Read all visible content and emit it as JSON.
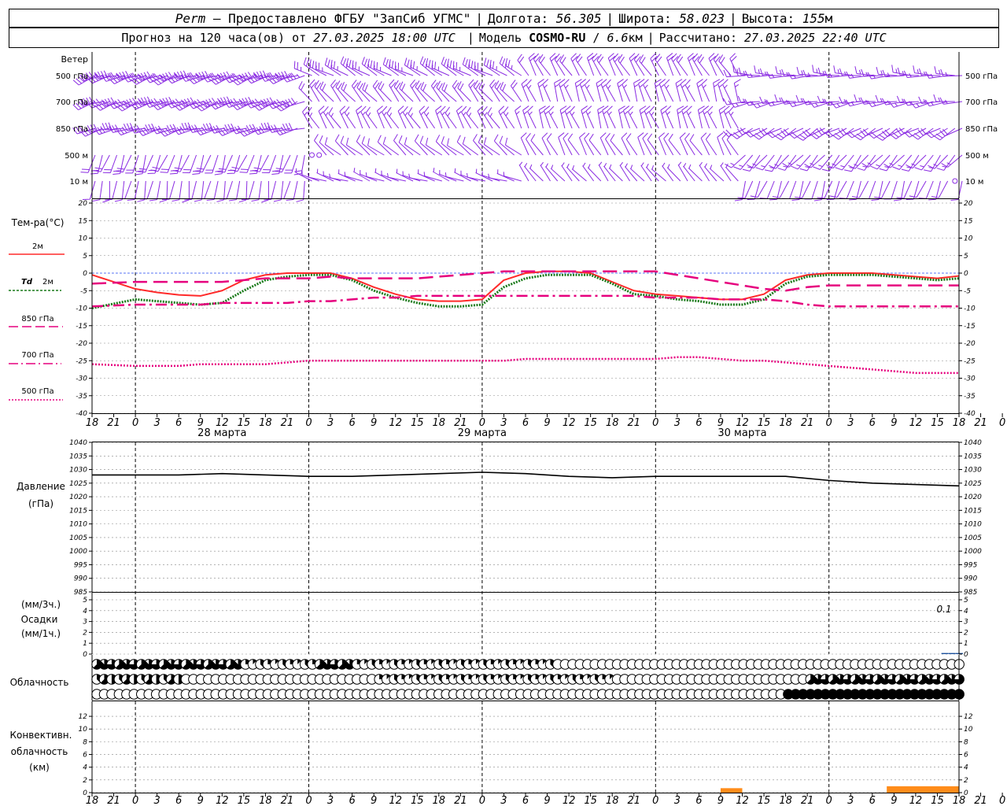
{
  "header": {
    "station": "Perm",
    "dash": "—",
    "provided_by": "Предоставлено ФГБУ \"ЗапСиб УГМС\"",
    "lon_label": "Долгота:",
    "lon_value": "56.305",
    "lat_label": "Широта:",
    "lat_value": "58.023",
    "alt_label": "Высота:",
    "alt_value": "155",
    "alt_unit": "м",
    "forecast_prefix": "Прогноз на 120 часа(ов) от",
    "forecast_start": "27.03.2025 18:00 UTC",
    "model_label": "Модель",
    "model_name": "COSMO-RU",
    "model_slash": "/",
    "model_res": "6.6",
    "model_res_unit": "км",
    "calc_label": "Рассчитано:",
    "calc_time": "27.03.2025 22:40 UTC"
  },
  "colors": {
    "wind": "#8a2be2",
    "t2m": "#ff2a2a",
    "td2m": "#1a7a1a",
    "upper": "#e6007e",
    "zero_line": "#3355ff",
    "pressure": "#000000",
    "precip": "#1b4f9c",
    "convective": "#ff8c1a",
    "grid": "#888888"
  },
  "chart_data": [
    {
      "type": "wind_barbs",
      "title": "Ветер",
      "levels": [
        "500 гПа",
        "700 гПа",
        "850 гПа",
        "500 м",
        "10  м"
      ],
      "time_step_hours": 1,
      "time_start_hour": 18,
      "calm_marks": [
        {
          "level": "500 м",
          "hours": [
            30,
            31
          ]
        },
        {
          "level": "10  м",
          "hours": [
            119
          ]
        }
      ],
      "segments": [
        {
          "from": 0,
          "to": 29,
          "dir_deg": [
            250,
            250,
            255,
            200,
            190
          ],
          "speed_kt": [
            45,
            40,
            30,
            20,
            10
          ]
        },
        {
          "from": 30,
          "to": 59,
          "dir_deg": [
            300,
            320,
            330,
            310,
            290
          ],
          "speed_kt": [
            25,
            20,
            15,
            10,
            5
          ]
        },
        {
          "from": 60,
          "to": 89,
          "dir_deg": [
            330,
            340,
            340,
            330,
            320
          ],
          "speed_kt": [
            20,
            15,
            15,
            10,
            5
          ]
        },
        {
          "from": 90,
          "to": 120,
          "dir_deg": [
            270,
            260,
            240,
            220,
            200
          ],
          "speed_kt": [
            15,
            15,
            20,
            15,
            10
          ]
        }
      ]
    },
    {
      "type": "line",
      "ylabel": "Тем-ра(°C)",
      "ylim": [
        -40,
        20
      ],
      "yticks": [
        -40,
        -35,
        -30,
        -25,
        -20,
        -15,
        -10,
        -5,
        0,
        5,
        10,
        15,
        20
      ],
      "x_hours": [
        0,
        6,
        9,
        12,
        15,
        18,
        21,
        24,
        27,
        30,
        33,
        36,
        39,
        42,
        45,
        48,
        51,
        54,
        57,
        60,
        63,
        66,
        69,
        72,
        75,
        78,
        81,
        84,
        87,
        90,
        93,
        96,
        99,
        102,
        105,
        108,
        111,
        114,
        117,
        120
      ],
      "series": [
        {
          "name": "2м",
          "values": [
            -0.5,
            -4.5,
            -5.5,
            -6.2,
            -6.5,
            -5,
            -2,
            -0.5,
            0,
            0,
            0,
            -1.5,
            -4,
            -6,
            -7.5,
            -8,
            -8,
            -7.5,
            -2,
            0,
            0.5,
            0.5,
            0,
            -2.5,
            -5,
            -6,
            -6.5,
            -7,
            -7.5,
            -7.5,
            -6,
            -2,
            -0.5,
            0,
            0,
            0,
            -0.5,
            -1,
            -1.5,
            -0.8
          ]
        },
        {
          "name": "Td 2м",
          "values": [
            -10,
            -7.5,
            -8,
            -8.5,
            -9,
            -8.5,
            -5,
            -2,
            -1,
            -0.5,
            -0.5,
            -2,
            -5,
            -7,
            -8.5,
            -9.5,
            -9.5,
            -9,
            -4,
            -1.5,
            -0.5,
            -0.5,
            -0.5,
            -3,
            -6,
            -6.5,
            -7.5,
            -8,
            -9,
            -9,
            -7.5,
            -3,
            -1,
            -0.5,
            -0.5,
            -0.5,
            -1,
            -1.5,
            -2,
            -1.5
          ]
        },
        {
          "name": "850 гПа",
          "values": [
            -3,
            -2.5,
            -2.5,
            -2.5,
            -2.5,
            -2.5,
            -2,
            -1.5,
            -1.5,
            -1.5,
            -1,
            -1.5,
            -1.5,
            -1.5,
            -1.5,
            -1,
            -0.5,
            0,
            0.5,
            0.5,
            0.5,
            0.5,
            0.5,
            0.5,
            0.5,
            0.5,
            -0.5,
            -1.5,
            -2.5,
            -3.5,
            -4.5,
            -5,
            -4,
            -3.5,
            -3.5,
            -3.5,
            -3.5,
            -3.5,
            -3.5,
            -3.5
          ]
        },
        {
          "name": "700 гПа",
          "values": [
            -9.5,
            -9,
            -9,
            -9,
            -9,
            -8.5,
            -8.5,
            -8.5,
            -8.5,
            -8,
            -8,
            -7.5,
            -7,
            -7,
            -6.5,
            -6.5,
            -6.5,
            -6.5,
            -6.5,
            -6.5,
            -6.5,
            -6.5,
            -6.5,
            -6.5,
            -6.5,
            -7,
            -7,
            -7,
            -7.5,
            -7.5,
            -7.5,
            -8,
            -9,
            -9.5,
            -9.5,
            -9.5,
            -9.5,
            -9.5,
            -9.5,
            -9.5
          ]
        },
        {
          "name": "500 гПа",
          "values": [
            -26,
            -26.5,
            -26.5,
            -26.5,
            -26,
            -26,
            -26,
            -26,
            -25.5,
            -25,
            -25,
            -25,
            -25,
            -25,
            -25,
            -25,
            -25,
            -25,
            -25,
            -24.5,
            -24.5,
            -24.5,
            -24.5,
            -24.5,
            -24.5,
            -24.5,
            -24,
            -24,
            -24.5,
            -25,
            -25,
            -25.5,
            -26,
            -26.5,
            -27,
            -27.5,
            -28,
            -28.5,
            -28.5,
            -28.5
          ]
        }
      ]
    },
    {
      "type": "line",
      "ylabel": "Давление",
      "yunit": "(гПа)",
      "ylim": [
        985,
        1040
      ],
      "yticks": [
        985,
        990,
        995,
        1000,
        1005,
        1010,
        1015,
        1020,
        1025,
        1030,
        1035,
        1040
      ],
      "x_hours": [
        0,
        6,
        12,
        18,
        24,
        30,
        36,
        42,
        48,
        54,
        60,
        66,
        72,
        78,
        84,
        90,
        96,
        102,
        108,
        114,
        120
      ],
      "series": [
        {
          "name": "Давление",
          "values": [
            1028,
            1028,
            1028,
            1028.5,
            1028,
            1027.5,
            1027.5,
            1028,
            1028.5,
            1029,
            1028.5,
            1027.5,
            1027,
            1027.5,
            1027.5,
            1027.5,
            1027.5,
            1026,
            1025,
            1024.5,
            1024
          ]
        }
      ]
    },
    {
      "type": "bar",
      "ylabel": "Осадки",
      "yunits": [
        "(мм/3ч.)",
        "(мм/1ч.)"
      ],
      "ylim": [
        0,
        5
      ],
      "yticks": [
        0,
        1,
        2,
        3,
        4,
        5
      ],
      "annotation": "0.1",
      "x_hours": [
        117,
        118,
        119,
        120
      ],
      "values": [
        0,
        0.1,
        0.1,
        0.1
      ]
    },
    {
      "type": "cloud_cover",
      "label": "Облачность",
      "rows": [
        "high",
        "mid",
        "low"
      ],
      "unit": "octas",
      "time_step_hours": 1,
      "columns": 117,
      "segments": [
        {
          "row": "high",
          "from": 0,
          "to": 19,
          "octas": 6
        },
        {
          "row": "high",
          "from": 20,
          "to": 29,
          "octas": 2
        },
        {
          "row": "high",
          "from": 30,
          "to": 34,
          "octas": 6
        },
        {
          "row": "high",
          "from": 35,
          "to": 61,
          "octas": 2
        },
        {
          "row": "high",
          "from": 62,
          "to": 116,
          "octas": 0
        },
        {
          "row": "mid",
          "from": 0,
          "to": 11,
          "octas": 4
        },
        {
          "row": "mid",
          "from": 12,
          "to": 37,
          "octas": 0
        },
        {
          "row": "mid",
          "from": 38,
          "to": 69,
          "octas": 2
        },
        {
          "row": "mid",
          "from": 70,
          "to": 95,
          "octas": 0
        },
        {
          "row": "mid",
          "from": 96,
          "to": 116,
          "octas": 6
        },
        {
          "row": "low",
          "from": 0,
          "to": 92,
          "octas": 0
        },
        {
          "row": "low",
          "from": 93,
          "to": 116,
          "octas": 8
        }
      ]
    },
    {
      "type": "area",
      "ylabel": "Конвективн.",
      "ylabel2": "облачность",
      "yunit": "(км)",
      "ylim": [
        0,
        13
      ],
      "yticks": [
        0,
        2,
        4,
        6,
        8,
        10,
        12
      ],
      "segments": [
        {
          "from_hour": 87,
          "to_hour": 90,
          "base_km": 0,
          "top_km": 0.7
        },
        {
          "from_hour": 110,
          "to_hour": 120,
          "base_km": 0,
          "top_km": 1
        }
      ]
    }
  ],
  "x_axis": {
    "hour_labels": [
      "18",
      "21",
      "0",
      "3",
      "6",
      "9",
      "12",
      "15",
      "18",
      "21",
      "0",
      "3",
      "6",
      "9",
      "12",
      "15",
      "18",
      "21",
      "0",
      "3",
      "6",
      "9",
      "12",
      "15",
      "18",
      "21",
      "0",
      "3",
      "6",
      "9",
      "12",
      "15",
      "18",
      "21",
      "0",
      "3",
      "6",
      "9",
      "12",
      "15",
      "18",
      "21",
      "0"
    ],
    "day_labels": [
      {
        "text": "28 марта",
        "center_hour": 18
      },
      {
        "text": "29 марта",
        "center_hour": 54
      },
      {
        "text": "30 марта",
        "center_hour": 90
      }
    ],
    "midnight_hours": [
      6,
      30,
      54,
      78,
      102
    ]
  },
  "legend": {
    "wind_title": "Ветер",
    "temp_title": "Тем-ра(°C)",
    "t2m": "2м",
    "td_prefix": "Td",
    "td_suffix": "2м",
    "p850": "850 гПа",
    "p700": "700 гПа",
    "p500": "500 гПа",
    "pressure_title": "Давление",
    "pressure_unit": "(гПа)",
    "precip_unit1": "(мм/3ч.)",
    "precip_title": "Осадки",
    "precip_unit2": "(мм/1ч.)",
    "cloud_title": "Облачность",
    "conv_title1": "Конвективн.",
    "conv_title2": "облачность",
    "conv_unit": "(км)"
  }
}
